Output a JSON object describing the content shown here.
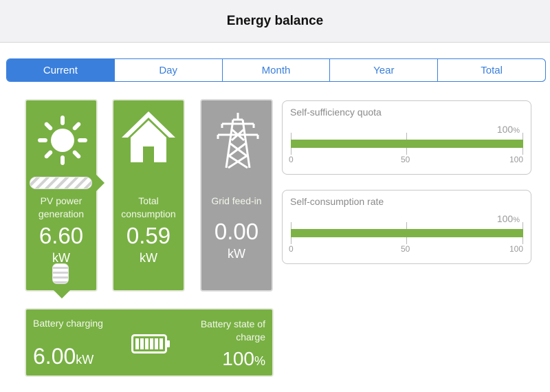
{
  "header": {
    "title": "Energy balance"
  },
  "tabs": [
    {
      "label": "Current",
      "active": true
    },
    {
      "label": "Day",
      "active": false
    },
    {
      "label": "Month",
      "active": false
    },
    {
      "label": "Year",
      "active": false
    },
    {
      "label": "Total",
      "active": false
    }
  ],
  "pv": {
    "label": "PV power generation",
    "value": "6.60",
    "unit": "kW",
    "icon": "sun-icon"
  },
  "consumption": {
    "label": "Total consumption",
    "value": "0.59",
    "unit": "kW",
    "icon": "house-icon"
  },
  "grid": {
    "label": "Grid feed-in",
    "value": "0.00",
    "unit": "kW",
    "icon": "power-pylon-icon"
  },
  "self_sufficiency": {
    "title": "Self-sufficiency quota",
    "value": "100",
    "unit": "%",
    "fill": 1.0,
    "ticks": [
      "0",
      "50",
      "100"
    ]
  },
  "self_consumption": {
    "title": "Self-consumption rate",
    "value": "100",
    "unit": "%",
    "fill": 1.0,
    "ticks": [
      "0",
      "50",
      "100"
    ]
  },
  "battery": {
    "charging_label": "Battery charging",
    "charging_value": "6.00",
    "charging_unit": "kW",
    "soc_label": "Battery state of charge",
    "soc_value": "100",
    "soc_unit": "%",
    "icon": "battery-icon"
  },
  "colors": {
    "accent": "#3a7fdc",
    "green": "#78b043",
    "gray": "#a2a2a2",
    "bar": "#7db246"
  }
}
